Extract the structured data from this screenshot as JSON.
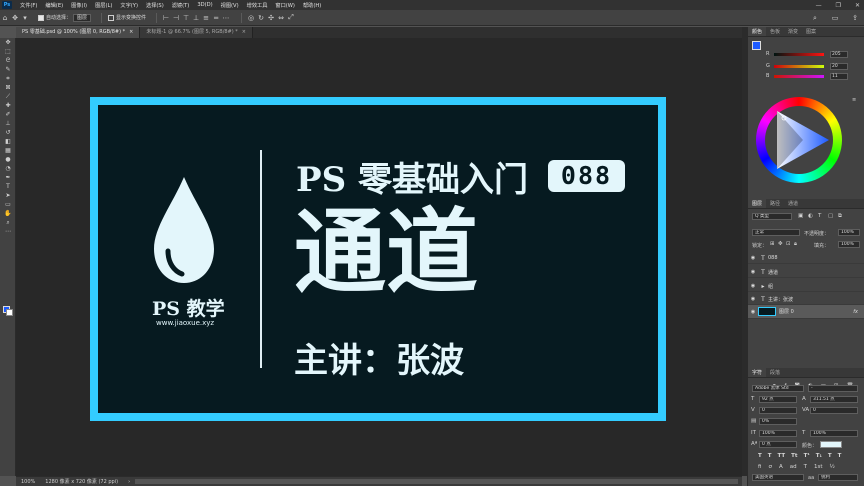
{
  "app": {
    "logo": "Ps"
  },
  "menu": [
    "文件(F)",
    "编辑(E)",
    "图像(I)",
    "图层(L)",
    "文字(Y)",
    "选择(S)",
    "滤镜(T)",
    "3D(D)",
    "视图(V)",
    "增效工具",
    "窗口(W)",
    "帮助(H)"
  ],
  "window_controls": [
    "—",
    "❐",
    "✕"
  ],
  "options": {
    "auto_select_label": "自动选择：",
    "auto_select_value": "图层",
    "show_transform_label": "显示变换控件"
  },
  "tabs": [
    {
      "label": "PS 零基础.psd @ 100% (图层 0, RGB/8#) *",
      "close": "×"
    },
    {
      "label": "未标题-1 @ 66.7% (图层 5, RGB/8#) *",
      "close": "×"
    }
  ],
  "artboard": {
    "brand": "PS 教学",
    "site": "www.jiaoxue.xyz",
    "title_line": "PS 零基础入门",
    "episode": "088",
    "topic": "通道",
    "speaker": "主讲：张波",
    "colors": {
      "frame": "#33ccff",
      "background": "#061a20",
      "text": "#e3f6fb"
    }
  },
  "status": {
    "zoom": "100%",
    "size": "1280 像素 x 720 像素 (72 ppi)"
  },
  "color_panel": {
    "tabs": [
      "颜色",
      "色板",
      "渐变",
      "图案"
    ],
    "r_label": "R",
    "r_value": "205",
    "g_label": "G",
    "g_value": "20",
    "b_label": "B",
    "b_value": "11"
  },
  "layers_panel": {
    "tabs": [
      "图层",
      "路径",
      "通道"
    ],
    "kind_label": "Q 类型",
    "blend_mode": "正常",
    "opacity_label": "不透明度：",
    "opacity_value": "100%",
    "lock_label": "锁定：",
    "fill_label": "填充：",
    "fill_value": "100%",
    "layers": [
      {
        "icon": "T",
        "name": "088"
      },
      {
        "icon": "T",
        "name": "通道"
      },
      {
        "icon": "▸",
        "name": "组"
      },
      {
        "icon": "T",
        "name": "主讲：张波"
      },
      {
        "icon": "▪",
        "name": "图层 0",
        "fx": "fx"
      }
    ]
  },
  "char_panel": {
    "tabs": [
      "字符",
      "段落"
    ],
    "font_family": "Adobe 黑体 Std",
    "font_style": "-",
    "font_size": "92 点",
    "leading": "311.51 点",
    "kerning": "0",
    "tracking": "0",
    "scale_pct": "0%",
    "v_scale": "100%",
    "h_scale": "100%",
    "baseline": "0 点",
    "color_label": "颜色：",
    "language": "美国英语",
    "aa_label": "aa",
    "aa_value": "锐利"
  }
}
